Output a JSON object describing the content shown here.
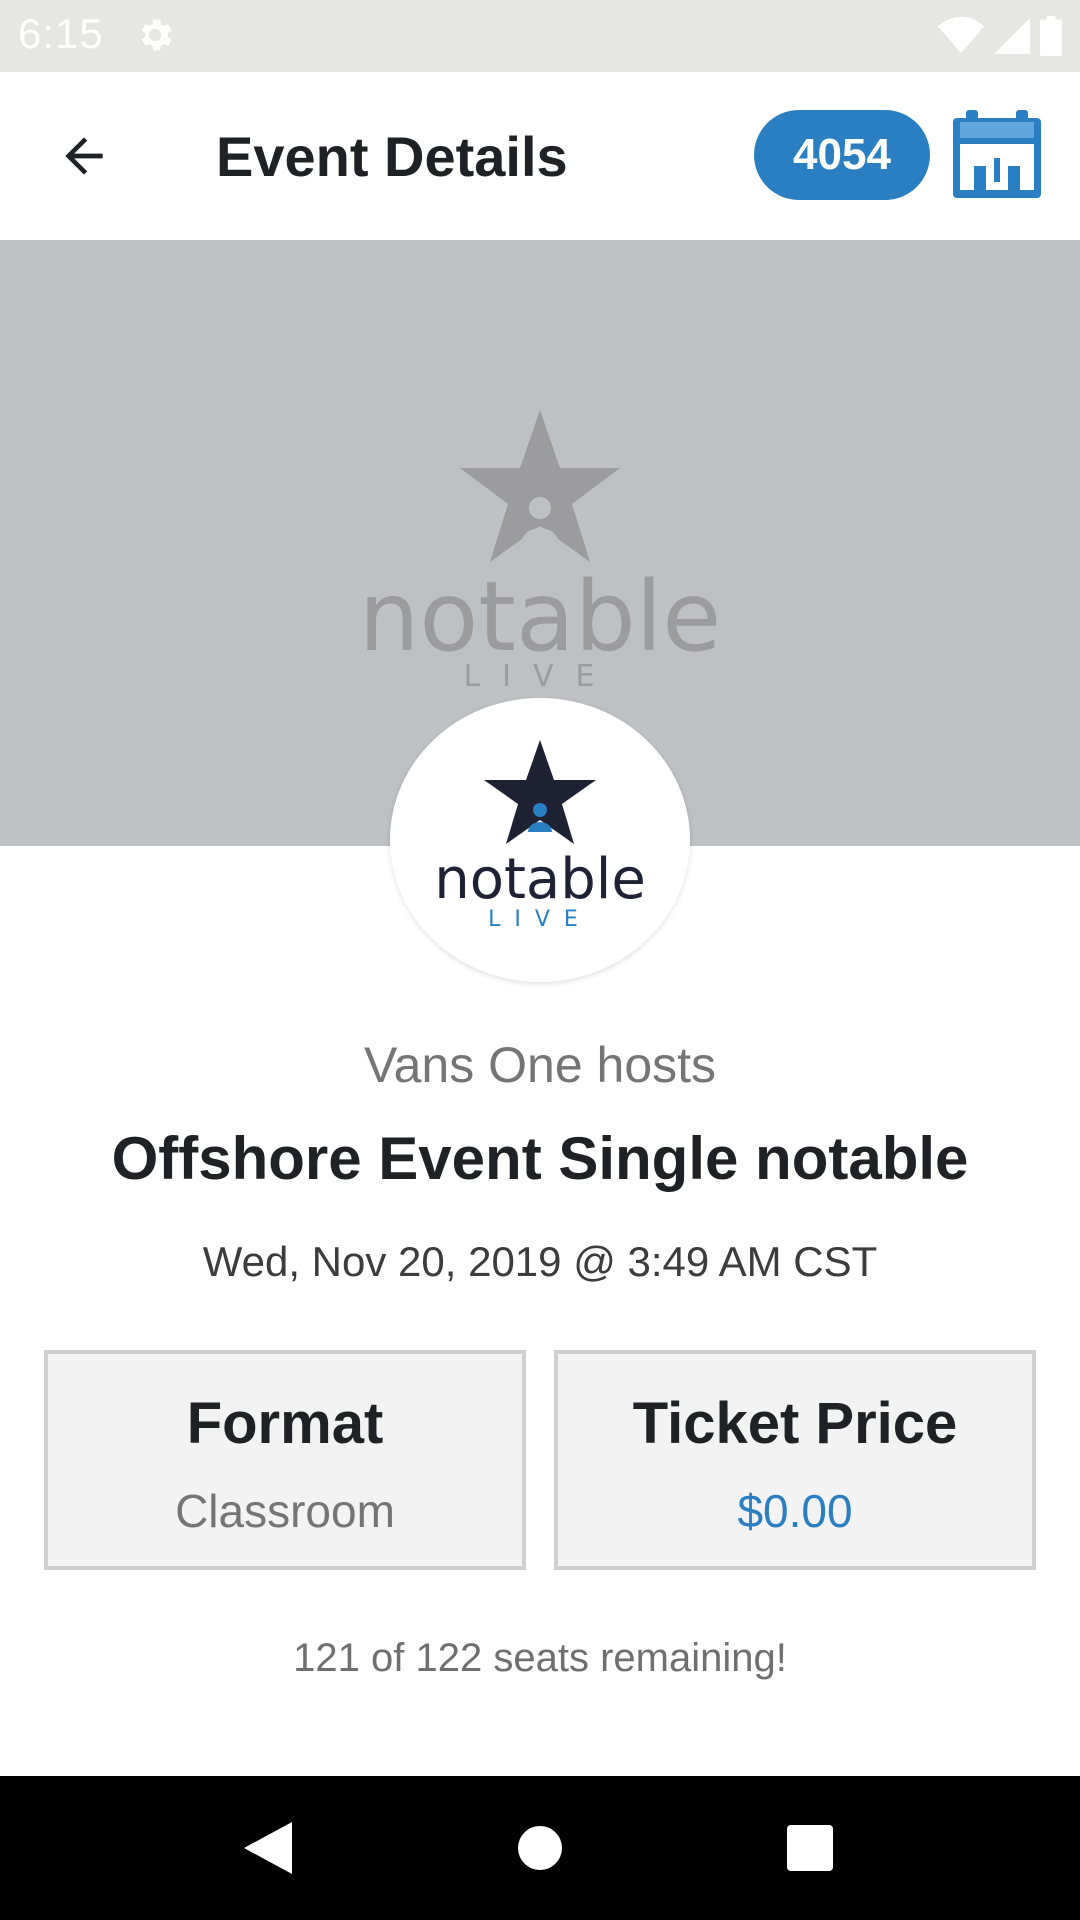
{
  "status_bar": {
    "time": "6:15"
  },
  "app_bar": {
    "title": "Event Details",
    "points_badge": "4054"
  },
  "banner": {
    "logo_word": "notable",
    "logo_sub": "LIVE"
  },
  "event": {
    "host_line": "Vans One hosts",
    "title": "Offshore Event Single notable",
    "datetime": "Wed, Nov 20, 2019 @ 3:49 AM CST",
    "format_label": "Format",
    "format_value": "Classroom",
    "price_label": "Ticket Price",
    "price_value": "$0.00",
    "seats_text": "121 of 122 seats remaining!"
  },
  "colors": {
    "accent": "#2a7fc3",
    "banner": "#bfc0c4",
    "status_bar": "#e6e6e4",
    "nav_bar": "#000000"
  },
  "icons": {
    "status": [
      "gear-icon",
      "wifi-icon",
      "signal-icon",
      "battery-icon"
    ],
    "app_bar": [
      "back-arrow-icon",
      "calendar-icon"
    ],
    "nav": [
      "nav-back-icon",
      "nav-home-icon",
      "nav-recents-icon"
    ]
  }
}
